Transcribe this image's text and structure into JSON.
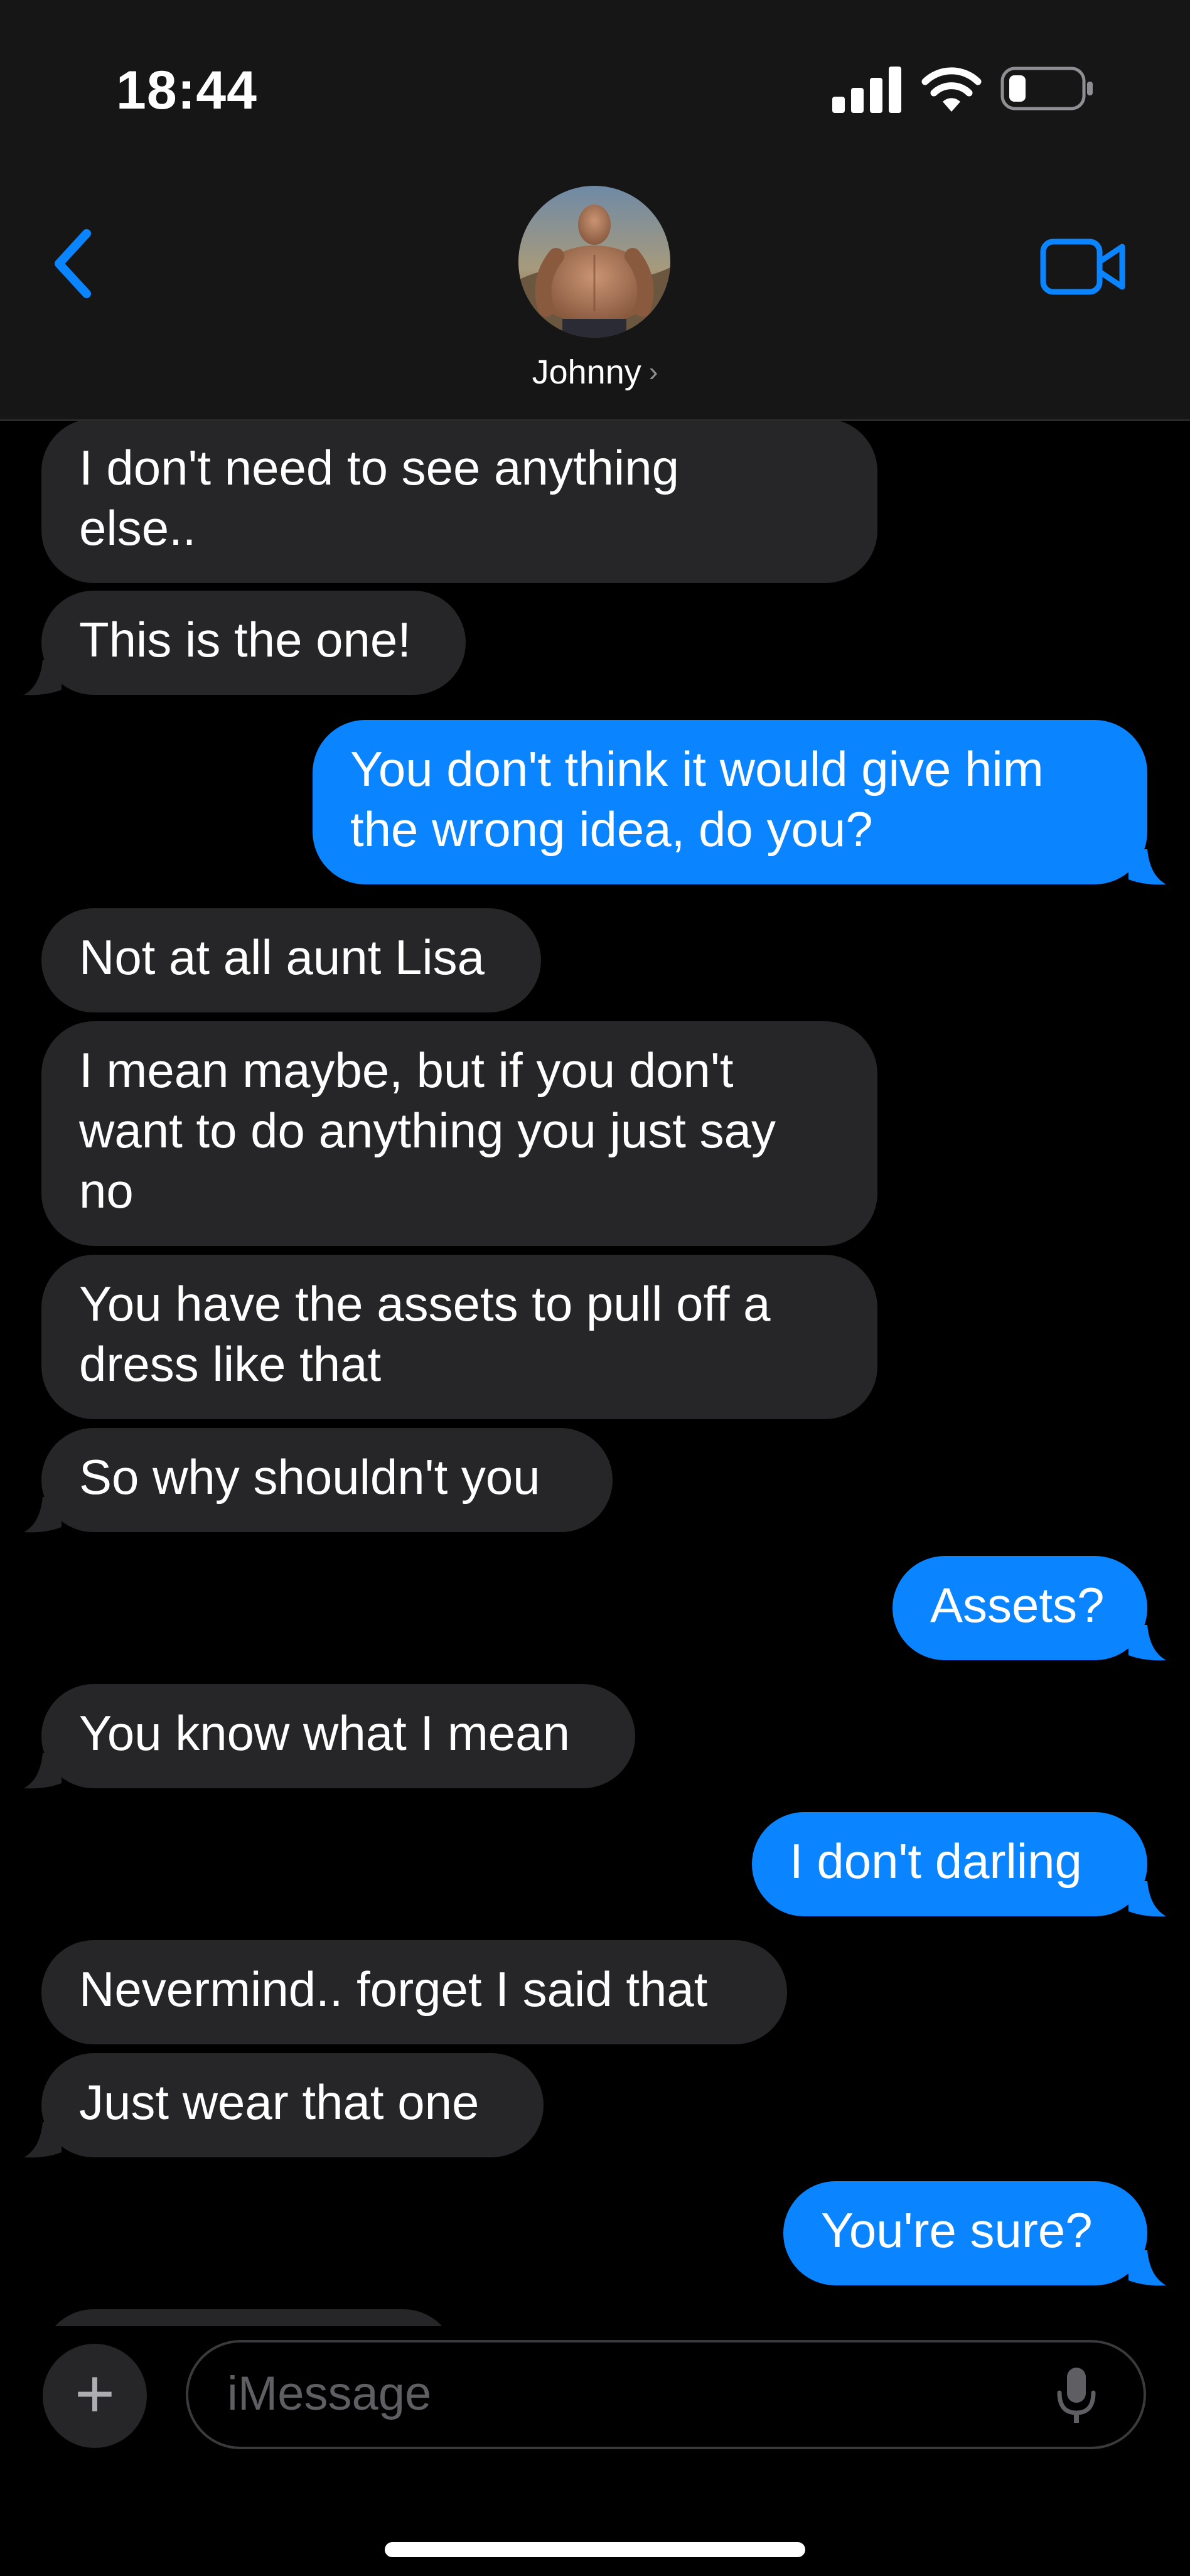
{
  "status_bar": {
    "time": "18:44"
  },
  "header": {
    "contact_name": "Johnny",
    "contact_chevron": "›",
    "back_icon": "chevron-left-icon",
    "video_icon": "video-camera-icon",
    "accent_color": "#0a84ff"
  },
  "messages": [
    {
      "side": "in",
      "text": "I don't need to see anything\nelse.."
    },
    {
      "side": "in",
      "text": "This is the one!"
    },
    {
      "side": "out",
      "text": "You don't think it would give him\nthe wrong idea, do you?"
    },
    {
      "side": "in",
      "text": "Not at all aunt Lisa"
    },
    {
      "side": "in",
      "text": "I mean maybe, but if you don't\nwant to do anything you just say\nno"
    },
    {
      "side": "in",
      "text": "You have the assets to pull off a\ndress like that"
    },
    {
      "side": "in",
      "text": "So why shouldn't you"
    },
    {
      "side": "out",
      "text": "Assets?"
    },
    {
      "side": "in",
      "text": "You know what I mean"
    },
    {
      "side": "out",
      "text": "I don't darling"
    },
    {
      "side": "in",
      "text": "Nevermind.. forget I said that"
    },
    {
      "side": "in",
      "text": "Just wear that one"
    },
    {
      "side": "out",
      "text": "You're sure?"
    }
  ],
  "composer": {
    "placeholder": "iMessage",
    "plus_label": "+",
    "mic_icon": "microphone-icon"
  },
  "colors": {
    "incoming_bubble": "#262628",
    "outgoing_bubble": "#0a84ff",
    "header_bg": "#161616"
  }
}
